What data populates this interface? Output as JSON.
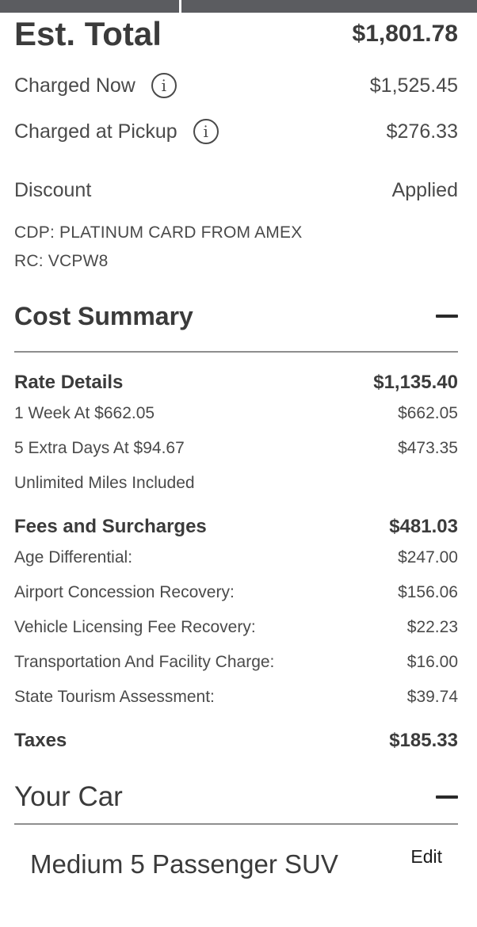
{
  "summary": {
    "est_total_label": "Est. Total",
    "est_total_value": "$1,801.78",
    "charged_now_label": "Charged Now",
    "charged_now_value": "$1,525.45",
    "charged_pickup_label": "Charged at Pickup",
    "charged_pickup_value": "$276.33",
    "info_glyph": "i",
    "info_icon": "info-circle-icon"
  },
  "discount": {
    "label": "Discount",
    "status": "Applied",
    "cdp": "CDP: PLATINUM CARD FROM AMEX",
    "rc": "RC: VCPW8"
  },
  "cost_summary": {
    "title": "Cost Summary",
    "collapse_icon": "minus-icon",
    "rate_details": {
      "label": "Rate Details",
      "total": "$1,135.40",
      "items": [
        {
          "label": "1 Week At $662.05",
          "value": "$662.05"
        },
        {
          "label": "5 Extra Days At $94.67",
          "value": "$473.35"
        },
        {
          "label": "Unlimited Miles Included",
          "value": ""
        }
      ]
    },
    "fees": {
      "label": "Fees and Surcharges",
      "total": "$481.03",
      "items": [
        {
          "label": "Age Differential:",
          "value": "$247.00"
        },
        {
          "label": "Airport Concession Recovery:",
          "value": "$156.06"
        },
        {
          "label": "Vehicle Licensing Fee Recovery:",
          "value": "$22.23"
        },
        {
          "label": "Transportation And Facility Charge:",
          "value": "$16.00"
        },
        {
          "label": "State Tourism Assessment:",
          "value": "$39.74"
        }
      ]
    },
    "taxes": {
      "label": "Taxes",
      "total": "$185.33"
    }
  },
  "your_car": {
    "title": "Your Car",
    "collapse_icon": "minus-icon",
    "car_name": "Medium 5 Passenger SUV",
    "edit_label": "Edit"
  },
  "colors": {
    "top_bar": "#5b5c60",
    "text_primary": "#3b3b3b",
    "divider": "#8e8e8e"
  }
}
